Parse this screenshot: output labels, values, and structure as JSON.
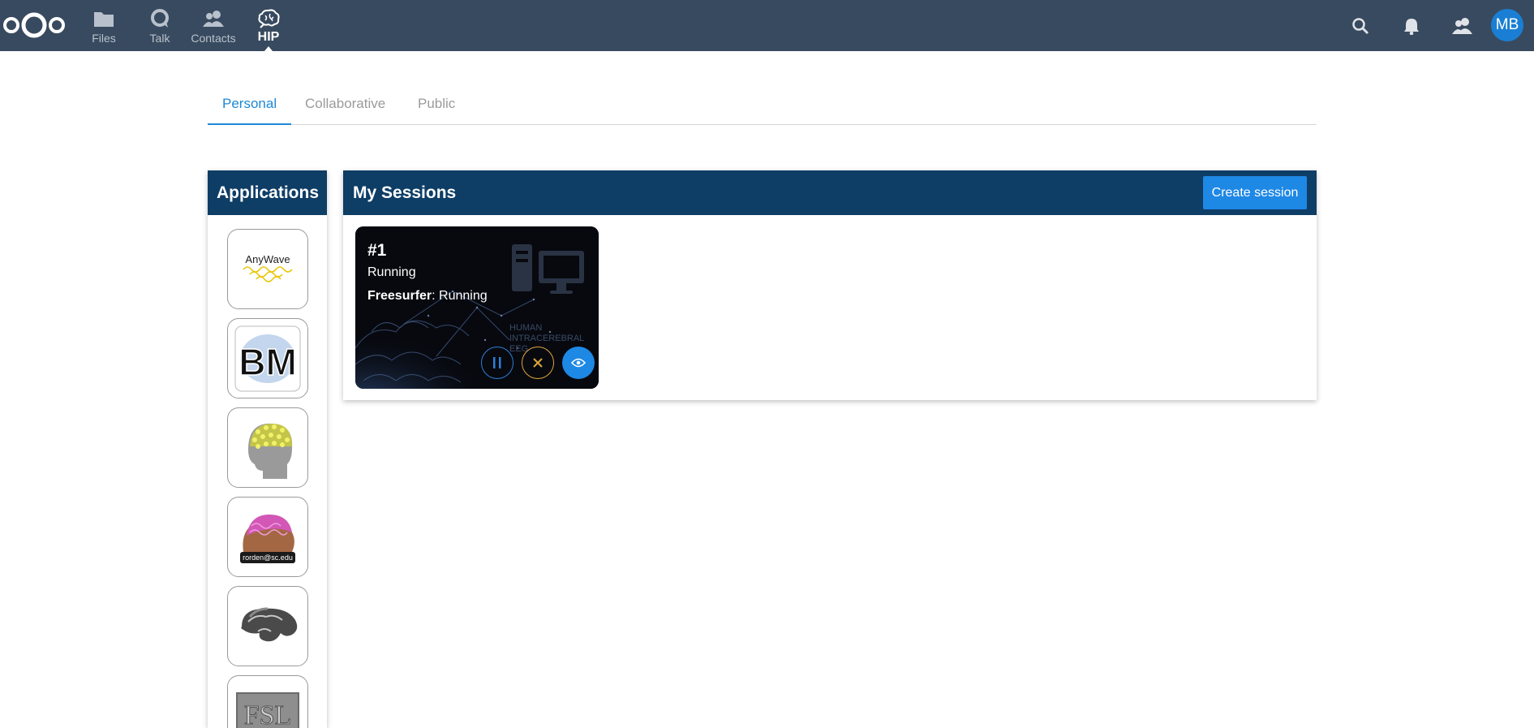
{
  "topbar": {
    "apps": [
      {
        "label": "Files",
        "icon": "folder-icon"
      },
      {
        "label": "Talk",
        "icon": "talk-icon"
      },
      {
        "label": "Contacts",
        "icon": "contacts-icon"
      },
      {
        "label": "HIP",
        "icon": "brain-icon",
        "active": true
      }
    ],
    "right_icons": [
      "search-icon",
      "bell-icon",
      "contacts-menu-icon"
    ],
    "avatar_initials": "MB",
    "bar_color": "#384a5f"
  },
  "tabs": [
    {
      "label": "Personal",
      "active": true
    },
    {
      "label": "Collaborative",
      "active": false
    },
    {
      "label": "Public",
      "active": false
    }
  ],
  "applications": {
    "title": "Applications",
    "tiles": [
      {
        "name": "anywave",
        "text": "AnyWave"
      },
      {
        "name": "bm",
        "text": "BM"
      },
      {
        "name": "eeg-head",
        "text": ""
      },
      {
        "name": "mricrogl",
        "text": "rorden@sc.edu"
      },
      {
        "name": "brain-3d",
        "text": ""
      },
      {
        "name": "fsl",
        "text": "FSL"
      }
    ]
  },
  "sessions": {
    "title": "My Sessions",
    "create_label": "Create session",
    "cards": [
      {
        "number": "#1",
        "status": "Running",
        "app_name": "Freesurfer",
        "app_status": ": Running",
        "overlay_text": "HUMAN INTRACEREBRAL EEG"
      }
    ]
  },
  "colors": {
    "accent": "#1e88e5",
    "header": "#0e3d66",
    "stop": "#e0a63a"
  }
}
